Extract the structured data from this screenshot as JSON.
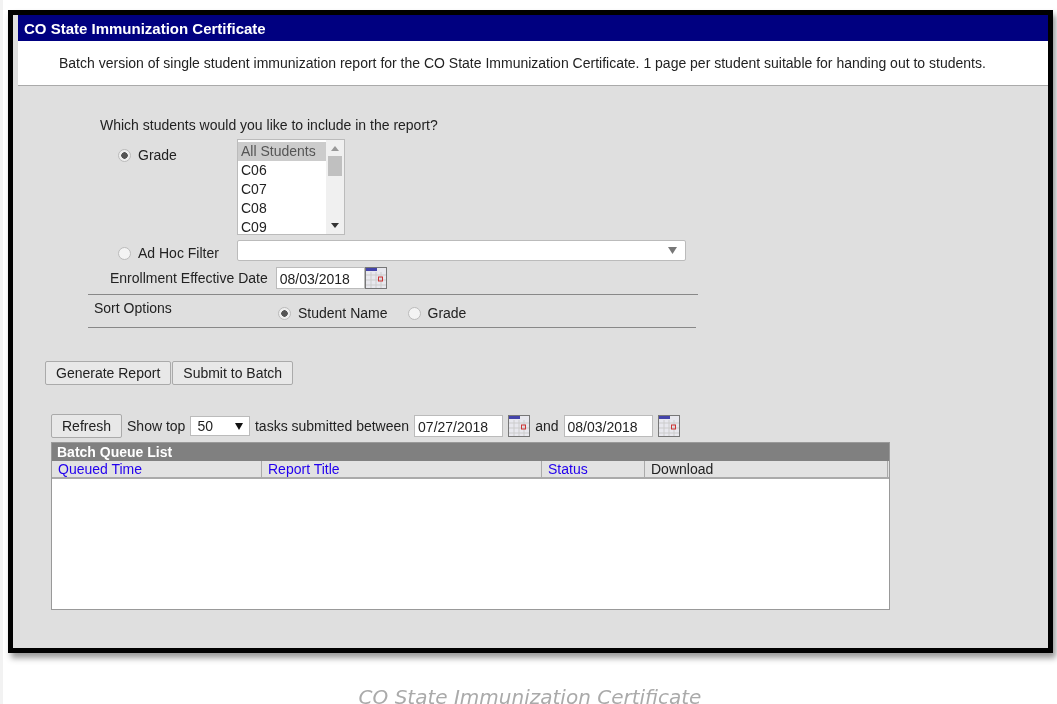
{
  "header": {
    "title": "CO State Immunization Certificate"
  },
  "description": "Batch version of single student immunization report for the CO State Immunization Certificate. 1 page per student suitable for handing out to students.",
  "filter": {
    "question": "Which students would you like to include in the report?",
    "options": [
      {
        "label": "Grade",
        "selected": true
      },
      {
        "label": "Ad Hoc Filter",
        "selected": false
      }
    ],
    "grade_list": [
      {
        "label": "All Students",
        "selected": true
      },
      {
        "label": "C06",
        "selected": false
      },
      {
        "label": "C07",
        "selected": false
      },
      {
        "label": "C08",
        "selected": false
      },
      {
        "label": "C09",
        "selected": false
      }
    ],
    "enrollment_date": {
      "label": "Enrollment Effective Date",
      "value": "08/03/2018"
    }
  },
  "sort": {
    "label": "Sort Options",
    "options": [
      {
        "label": "Student Name",
        "selected": true
      },
      {
        "label": "Grade",
        "selected": false
      }
    ]
  },
  "buttons": [
    "Generate Report",
    "Submit to Batch"
  ],
  "queue_filter": {
    "refresh": "Refresh",
    "show_top_label": "Show top",
    "show_top_value": "50",
    "between_label": "tasks submitted between",
    "start_date": "07/27/2018",
    "and_label": "and",
    "end_date": "08/03/2018"
  },
  "batch_queue": {
    "title": "Batch Queue List",
    "columns": [
      {
        "label": "Queued Time",
        "sortable": true
      },
      {
        "label": "Report Title",
        "sortable": true
      },
      {
        "label": "Status",
        "sortable": true
      },
      {
        "label": "Download",
        "sortable": false
      }
    ]
  },
  "caption": "CO State Immunization Certificate"
}
